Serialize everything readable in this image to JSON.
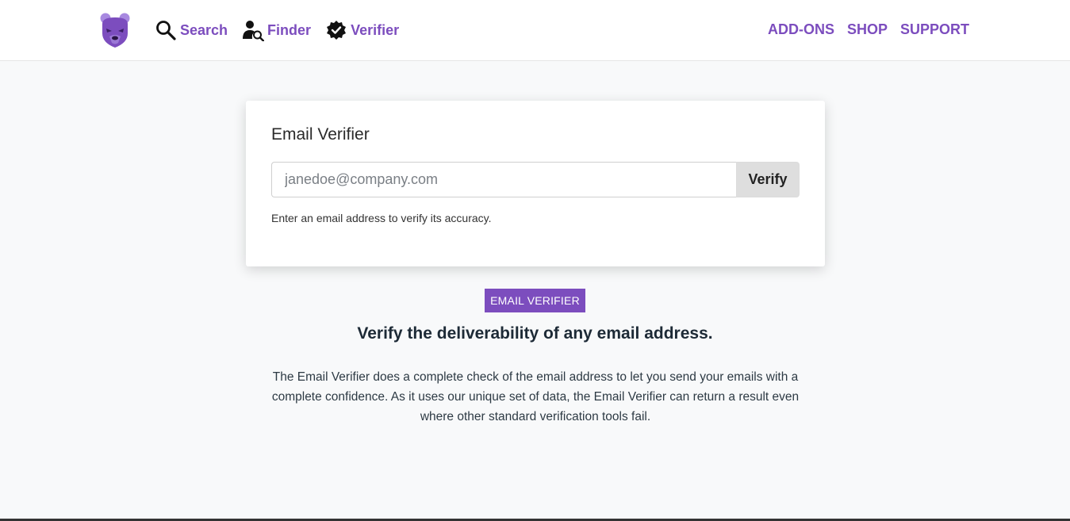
{
  "nav": {
    "left": [
      {
        "label": "Search",
        "icon": "search-icon"
      },
      {
        "label": "Finder",
        "icon": "person-search-icon"
      },
      {
        "label": "Verifier",
        "icon": "verified-badge-icon"
      }
    ],
    "right": [
      "ADD-ONS",
      "SHOP",
      "SUPPORT"
    ]
  },
  "card": {
    "title": "Email Verifier",
    "input_placeholder": "janedoe@company.com",
    "input_value": "",
    "button_label": "Verify",
    "hint": "Enter an email address to verify its accuracy."
  },
  "info": {
    "badge": "EMAIL VERIFIER",
    "headline": "Verify the deliverability of any email address.",
    "description": "The Email Verifier does a complete check of the email address to let you send your emails with a complete confidence. As it uses our unique set of data, the Email Verifier can return a result even where other standard verification tools fail."
  },
  "colors": {
    "accent": "#7c4dbe",
    "background": "#f8f9fa"
  }
}
